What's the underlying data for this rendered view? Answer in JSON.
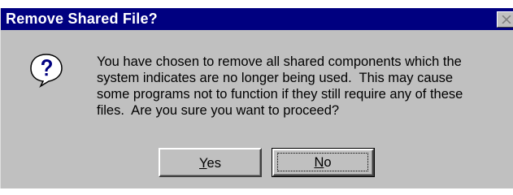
{
  "window": {
    "title": "Remove Shared File?",
    "close_glyph": "✕"
  },
  "dialog": {
    "icon": "question-icon",
    "message": "You have chosen to remove all shared components which the\nsystem indicates are no longer being used.  This may cause\nsome programs not to function if they still require any of these\nfiles.  Are you sure you want to proceed?"
  },
  "buttons": {
    "yes": {
      "accel": "Y",
      "rest": "es"
    },
    "no": {
      "accel": "N",
      "rest": "o"
    }
  },
  "colors": {
    "title_bar": "#000080",
    "face": "#c0c0c0",
    "icon_bubble": "#ffffff",
    "icon_mark": "#000080"
  }
}
